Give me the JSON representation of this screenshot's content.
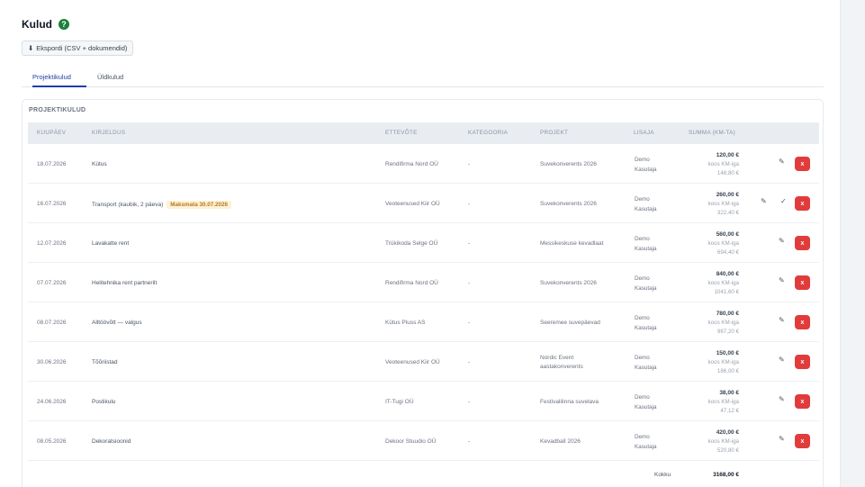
{
  "page": {
    "title": "Kulud",
    "help_icon": "?",
    "export_label": "Ekspordi (CSV + dokumendid)"
  },
  "tabs": [
    {
      "label": "Projektikulud",
      "active": true
    },
    {
      "label": "Üldkulud",
      "active": false
    }
  ],
  "table": {
    "section_title": "PROJEKTIKULUD",
    "headers": [
      "KUUPÄEV",
      "KIRJELDUS",
      "ETTEVÕTE",
      "KATEGOORIA",
      "PROJEKT",
      "LISAJA",
      "SUMMA (KM-TA)"
    ],
    "rows": [
      {
        "date": "18.07.2026",
        "description": "Kütus",
        "badge": "",
        "company": "Rendifirma Nord OÜ",
        "category": "-",
        "project": "Suvekonverents 2026",
        "adder": "Demo Kasutaja",
        "amount": "120,00 €",
        "vat_label": "koos KM-iga",
        "gross": "148,80 €",
        "actions": [
          "edit-icon",
          "delete-button"
        ]
      },
      {
        "date": "16.07.2026",
        "description": "Transport (kaubik, 2 päeva)",
        "badge": "Maksmata 30.07.2026",
        "company": "Veoteenused Kiir OÜ",
        "category": "-",
        "project": "Suvekonverents 2026",
        "adder": "Demo Kasutaja",
        "amount": "260,00 €",
        "vat_label": "koos KM-iga",
        "gross": "322,40 €",
        "actions": [
          "edit-icon",
          "check-icon",
          "delete-button"
        ]
      },
      {
        "date": "12.07.2026",
        "description": "Lavakatte rent",
        "badge": "",
        "company": "Trükikoda Selge OÜ",
        "category": "-",
        "project": "Messikeskuse kevadlaat",
        "adder": "Demo Kasutaja",
        "amount": "560,00 €",
        "vat_label": "koos KM-iga",
        "gross": "694,40 €",
        "actions": [
          "edit-icon",
          "delete-button"
        ]
      },
      {
        "date": "07.07.2026",
        "description": "Helitehnika rent partnerilt",
        "badge": "",
        "company": "Rendifirma Nord OÜ",
        "category": "-",
        "project": "Suvekonverents 2026",
        "adder": "Demo Kasutaja",
        "amount": "840,00 €",
        "vat_label": "koos KM-iga",
        "gross": "1041,60 €",
        "actions": [
          "edit-icon",
          "delete-button"
        ]
      },
      {
        "date": "08.07.2026",
        "description": "Alltöövõtt — valgus",
        "badge": "",
        "company": "Kütus Pluss AS",
        "category": "-",
        "project": "Seeremee suvepäevad",
        "adder": "Demo Kasutaja",
        "amount": "780,00 €",
        "vat_label": "koos KM-iga",
        "gross": "967,20 €",
        "actions": [
          "edit-icon",
          "delete-button"
        ]
      },
      {
        "date": "30.06.2026",
        "description": "Tõõriistad",
        "badge": "",
        "company": "Veoteenused Kiir OÜ",
        "category": "-",
        "project": "Nordic Event aastakonverents",
        "adder": "Demo Kasutaja",
        "amount": "150,00 €",
        "vat_label": "koos KM-iga",
        "gross": "186,00 €",
        "actions": [
          "edit-icon",
          "delete-button"
        ]
      },
      {
        "date": "24.06.2026",
        "description": "Postikulu",
        "badge": "",
        "company": "IT-Tugi OÜ",
        "category": "-",
        "project": "Festivalilinna suvelava",
        "adder": "Demo Kasutaja",
        "amount": "38,00 €",
        "vat_label": "koos KM-iga",
        "gross": "47,12 €",
        "actions": [
          "edit-icon",
          "delete-button"
        ]
      },
      {
        "date": "08.05.2026",
        "description": "Dekoratsioonid",
        "badge": "",
        "company": "Dekoor Stuudio OÜ",
        "category": "-",
        "project": "Kevadball 2026",
        "adder": "Demo Kasutaja",
        "amount": "420,00 €",
        "vat_label": "koos KM-iga",
        "gross": "520,80 €",
        "actions": [
          "edit-icon",
          "delete-button"
        ]
      }
    ],
    "total_label": "Kokku",
    "total_value": "3168,00 €"
  },
  "icons": {
    "export": "download-icon",
    "edit": "edit-icon",
    "check": "check-icon",
    "delete": "delete-button"
  },
  "colors": {
    "accent": "#1d3fa6",
    "delete": "#e23b3b",
    "help": "#1a7f3c",
    "badge_bg": "#fdf1d6",
    "badge_text": "#b7791f"
  }
}
